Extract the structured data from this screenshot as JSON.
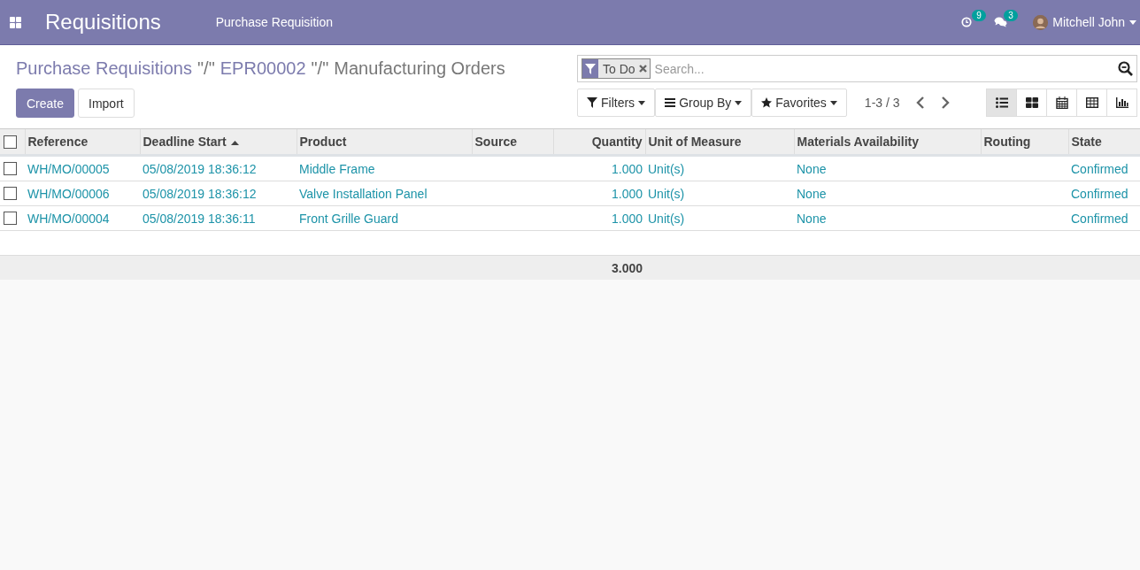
{
  "navbar": {
    "app_title": "Requisitions",
    "menu": [
      "Purchase Requisition"
    ],
    "activity_count": "9",
    "message_count": "3",
    "user": "Mitchell John"
  },
  "breadcrumbs": {
    "separator": "\"/\"",
    "items": [
      "Purchase Requisitions",
      "EPR00002",
      "Manufacturing Orders"
    ]
  },
  "buttons": [
    {
      "label": "Create",
      "kind": "primary"
    },
    {
      "label": "Import",
      "kind": "secondary"
    }
  ],
  "search": {
    "facet": "To Do",
    "placeholder": "Search..."
  },
  "search_options": [
    {
      "label": "Filters",
      "kind": "filter"
    },
    {
      "label": "Group By",
      "kind": "group"
    },
    {
      "label": "Favorites",
      "kind": "favorite"
    }
  ],
  "pager": "1-3 / 3",
  "views": [
    {
      "kind": "list",
      "selected": true
    },
    {
      "kind": "kanban",
      "selected": false
    },
    {
      "kind": "calendar",
      "selected": false
    },
    {
      "kind": "pivot",
      "selected": false
    },
    {
      "kind": "graph",
      "selected": false
    }
  ],
  "table": {
    "columns": [
      {
        "label": "Reference",
        "kind": "text",
        "sorted": false
      },
      {
        "label": "Deadline Start",
        "kind": "text",
        "sorted": true
      },
      {
        "label": "Product",
        "kind": "text",
        "sorted": false
      },
      {
        "label": "Source",
        "kind": "text",
        "sorted": false
      },
      {
        "label": "Quantity",
        "kind": "number",
        "sorted": false,
        "total": "3.000"
      },
      {
        "label": "Unit of Measure",
        "kind": "text",
        "sorted": false
      },
      {
        "label": "Materials Availability",
        "kind": "text",
        "sorted": false
      },
      {
        "label": "Routing",
        "kind": "text",
        "sorted": false
      },
      {
        "label": "State",
        "kind": "text",
        "sorted": false
      }
    ],
    "select_all_checked": false,
    "rows": [
      {
        "checked": false,
        "cells": [
          "WH/MO/00005",
          "05/08/2019 18:36:12",
          "Middle Frame",
          "",
          "1.000",
          "Unit(s)",
          "None",
          "",
          "Confirmed"
        ]
      },
      {
        "checked": false,
        "cells": [
          "WH/MO/00006",
          "05/08/2019 18:36:12",
          "Valve Installation Panel",
          "",
          "1.000",
          "Unit(s)",
          "None",
          "",
          "Confirmed"
        ]
      },
      {
        "checked": false,
        "cells": [
          "WH/MO/00004",
          "05/08/2019 18:36:11",
          "Front Grille Guard",
          "",
          "1.000",
          "Unit(s)",
          "None",
          "",
          "Confirmed"
        ]
      }
    ]
  }
}
